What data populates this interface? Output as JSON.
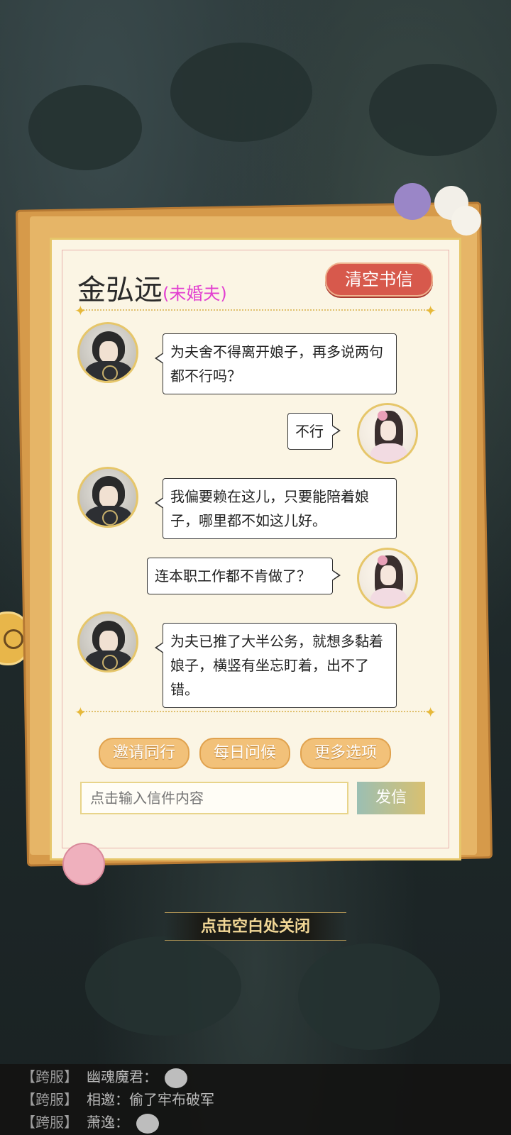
{
  "letter": {
    "name": "金弘远",
    "relation": "(未婚夫)",
    "clear_label": "清空书信",
    "messages": [
      {
        "from": "male",
        "text": "为夫舍不得离开娘子，再多说两句都不行吗？"
      },
      {
        "from": "female",
        "text": "不行"
      },
      {
        "from": "male",
        "text": "我偏要赖在这儿，只要能陪着娘子，哪里都不如这儿好。"
      },
      {
        "from": "female",
        "text": "连本职工作都不肯做了？"
      },
      {
        "from": "male",
        "text": "为夫已推了大半公务，就想多黏着娘子，横竖有坐忘盯着，出不了错。"
      }
    ],
    "actions": [
      "邀请同行",
      "每日问候",
      "更多选项"
    ],
    "input_placeholder": "点击输入信件内容",
    "send_label": "发信"
  },
  "close_hint": "点击空白处关闭",
  "chat": [
    {
      "tag": "【跨服】",
      "user": "幽魂魔君：",
      "text": "",
      "emote": "face-emote-icon"
    },
    {
      "tag": "【跨服】",
      "user": "相邀：",
      "text": "偷了牢布破军",
      "emote": ""
    },
    {
      "tag": "【跨服】",
      "user": "萧逸：",
      "text": "",
      "emote": "face-emote-icon"
    }
  ],
  "colors": {
    "clear_button": "#d7594c",
    "relation": "#e23fd0",
    "action_button": "#f2c179",
    "background": "#1f2a2c"
  }
}
